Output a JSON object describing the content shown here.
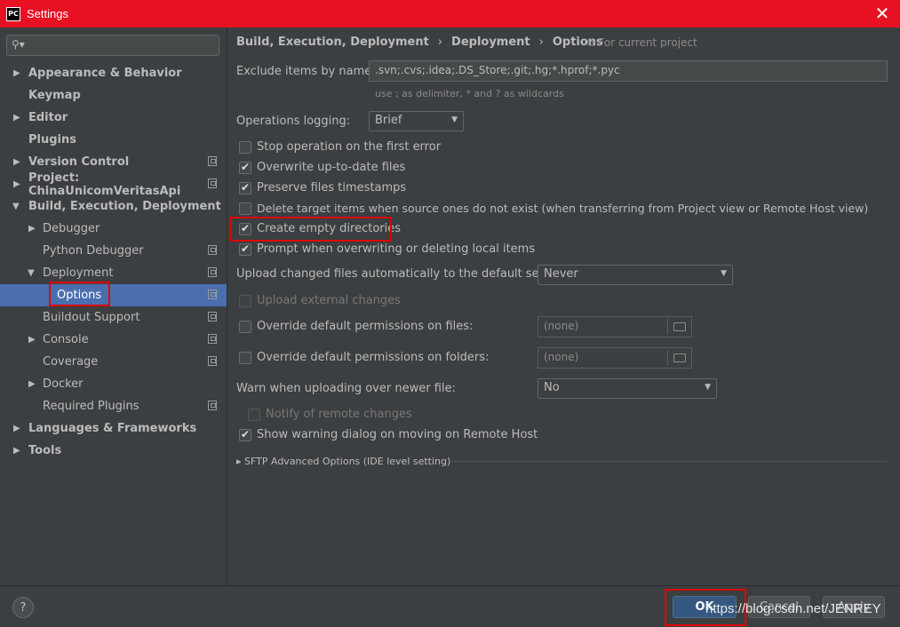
{
  "window": {
    "title": "Settings",
    "logo_text": "PC"
  },
  "sidebar": {
    "search_placeholder": "",
    "items": [
      {
        "label": "Appearance & Behavior"
      },
      {
        "label": "Keymap"
      },
      {
        "label": "Editor"
      },
      {
        "label": "Plugins"
      },
      {
        "label": "Version Control"
      },
      {
        "label": "Project: ChinaUnicomVeritasApi"
      },
      {
        "label": "Build, Execution, Deployment"
      },
      {
        "label": "Debugger"
      },
      {
        "label": "Python Debugger"
      },
      {
        "label": "Deployment"
      },
      {
        "label": "Options"
      },
      {
        "label": "Buildout Support"
      },
      {
        "label": "Console"
      },
      {
        "label": "Coverage"
      },
      {
        "label": "Docker"
      },
      {
        "label": "Required Plugins"
      },
      {
        "label": "Languages & Frameworks"
      },
      {
        "label": "Tools"
      }
    ]
  },
  "breadcrumb": {
    "items": [
      "Build, Execution, Deployment",
      "Deployment",
      "Options"
    ],
    "separator": "›",
    "note": "For current project"
  },
  "options": {
    "exclude_label": "Exclude items by name:",
    "exclude_value": ".svn;.cvs;.idea;.DS_Store;.git;.hg;*.hprof;*.pyc",
    "exclude_hint": "use ; as delimiter, * and ? as wildcards",
    "logging_label": "Operations logging:",
    "logging_value": "Brief",
    "stop_on_error": "Stop operation on the first error",
    "overwrite": "Overwrite up-to-date files",
    "preserve": "Preserve files timestamps",
    "delete_target": "Delete target items when source ones do not exist (when transferring from Project view or Remote Host view)",
    "create_empty": "Create empty directories",
    "prompt": "Prompt when overwriting or deleting local items",
    "upload_label": "Upload changed files automatically to the default server",
    "upload_value": "Never",
    "upload_external": "Upload external changes",
    "override_files": "Override default permissions on files:",
    "override_files_value": "(none)",
    "override_folders": "Override default permissions on folders:",
    "override_folders_value": "(none)",
    "warn_label": "Warn when uploading over newer file:",
    "warn_value": "No",
    "notify_remote": "Notify of remote changes",
    "show_warning": "Show warning dialog on moving on Remote Host",
    "sftp": "SFTP Advanced Options (IDE level setting)"
  },
  "footer": {
    "help": "?",
    "ok": "OK",
    "cancel": "Cancel",
    "apply": "Apply",
    "watermark": "https://blog.csdn.net/JENREY"
  },
  "colors": {
    "titlebar": "#e81123",
    "selection": "#4b6eaf",
    "highlight": "#e00000"
  }
}
